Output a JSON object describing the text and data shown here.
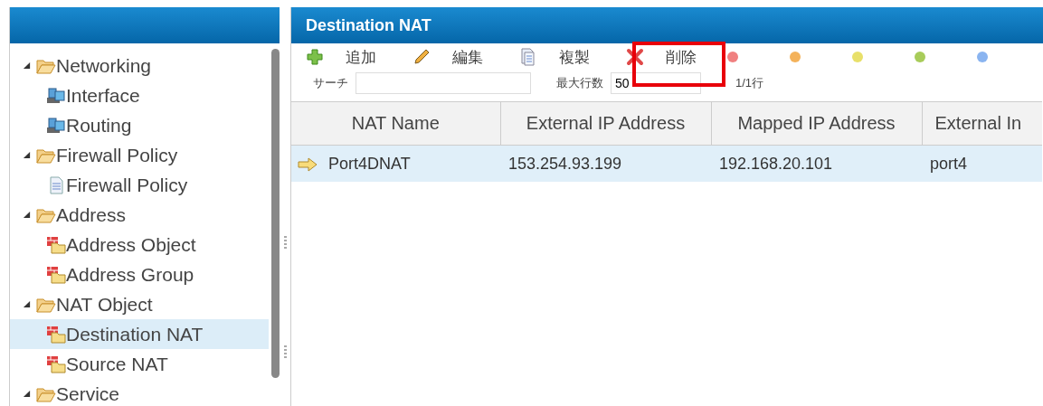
{
  "sidebar": {
    "items": [
      {
        "label": "Networking",
        "kind": "folder",
        "expanded": true,
        "children": [
          {
            "label": "Interface",
            "kind": "network",
            "selected": false
          },
          {
            "label": "Routing",
            "kind": "network",
            "selected": false
          }
        ]
      },
      {
        "label": "Firewall Policy",
        "kind": "folder",
        "expanded": true,
        "children": [
          {
            "label": "Firewall Policy",
            "kind": "document",
            "selected": false
          }
        ]
      },
      {
        "label": "Address",
        "kind": "folder",
        "expanded": true,
        "children": [
          {
            "label": "Address Object",
            "kind": "object",
            "selected": false
          },
          {
            "label": "Address Group",
            "kind": "object",
            "selected": false
          }
        ]
      },
      {
        "label": "NAT Object",
        "kind": "folder",
        "expanded": true,
        "children": [
          {
            "label": "Destination NAT",
            "kind": "object",
            "selected": true
          },
          {
            "label": "Source NAT",
            "kind": "object",
            "selected": false
          }
        ]
      },
      {
        "label": "Service",
        "kind": "folder",
        "expanded": true
      }
    ]
  },
  "panel": {
    "title": "Destination NAT",
    "toolbar": [
      {
        "kind": "add",
        "label": "追加"
      },
      {
        "kind": "edit",
        "label": "編集"
      },
      {
        "kind": "copy",
        "label": "複製"
      },
      {
        "kind": "delete",
        "label": "削除"
      }
    ],
    "color_filters": [
      {
        "color": "#f08080"
      },
      {
        "color": "#f4b25a"
      },
      {
        "color": "#e8e06a"
      },
      {
        "color": "#a8cc5a"
      },
      {
        "color": "#8ab4f0"
      }
    ],
    "search": {
      "label": "サーチ"
    },
    "max_rows": {
      "label": "最大行数",
      "value": "50"
    },
    "row_count": "1/1行",
    "table": {
      "columns": [
        "NAT Name",
        "External IP Address",
        "Mapped IP Address",
        "External In"
      ],
      "rows": [
        {
          "selected": true,
          "cells": [
            "Port4DNAT",
            "153.254.93.199",
            "192.168.20.101",
            "port4"
          ]
        }
      ]
    }
  }
}
